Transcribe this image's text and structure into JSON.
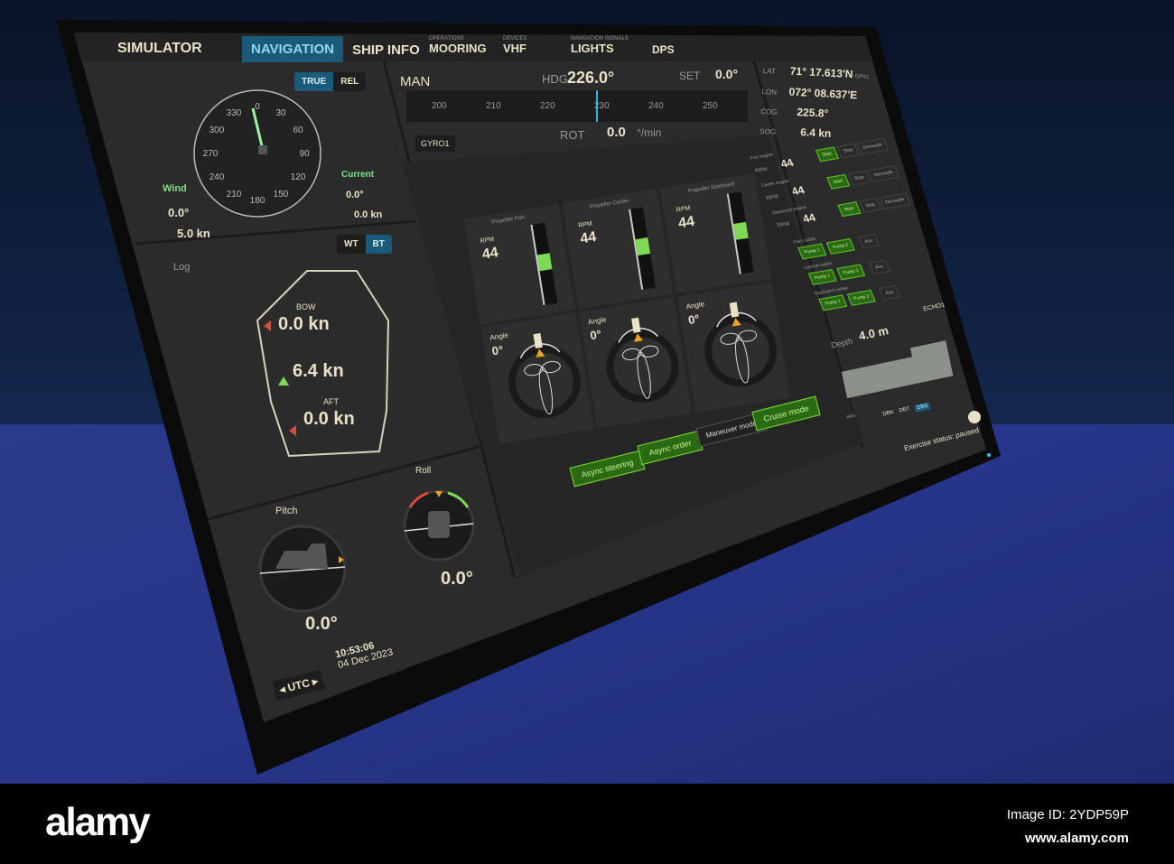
{
  "tabs": [
    {
      "label": "SIMULATOR",
      "sub": ""
    },
    {
      "label": "NAVIGATION",
      "sub": ""
    },
    {
      "label": "SHIP INFO",
      "sub": ""
    },
    {
      "label": "MOORING",
      "sub": "OPERATIONS"
    },
    {
      "label": "VHF",
      "sub": "DEVICES"
    },
    {
      "label": "LIGHTS",
      "sub": "NAVIGATION SIGNALS"
    },
    {
      "label": "DPS",
      "sub": ""
    }
  ],
  "wind": {
    "mode_true": "TRUE",
    "mode_rel": "REL",
    "compass_ticks": [
      "0",
      "30",
      "60",
      "90",
      "120",
      "150",
      "180",
      "210",
      "240",
      "270",
      "300",
      "330"
    ],
    "wind_label": "Wind",
    "wind_dir": "0.0°",
    "wind_speed": "5.0 kn",
    "current_label": "Current",
    "current_dir": "0.0°",
    "current_speed": "0.0 kn"
  },
  "heading": {
    "mode": "MAN",
    "hdg_label": "HDG",
    "hdg_value": "226.0°",
    "set_label": "SET",
    "set_value": "0.0°",
    "scale": [
      "200",
      "210",
      "220",
      "230",
      "240",
      "250"
    ],
    "rot_label": "ROT",
    "rot_value": "0.0",
    "rot_unit": "°/min",
    "gyro": "GYRO1"
  },
  "position": {
    "lat_label": "LAT",
    "lat": "71° 17.613'N",
    "gps": "GPS1",
    "lon_label": "LON",
    "lon": "072° 08.637'E",
    "cog_label": "COG",
    "cog": "225.8°",
    "sog_label": "SOG",
    "sog": "6.4 kn"
  },
  "engines": [
    {
      "name": "Port engine",
      "rpm_label": "RPM",
      "rpm": "44",
      "start": "Start",
      "stop": "Stop",
      "third": "Decouple"
    },
    {
      "name": "Center engine",
      "rpm_label": "RPM",
      "rpm": "44",
      "start": "Start",
      "stop": "Stop",
      "third": "Decouple"
    },
    {
      "name": "Starboard engine",
      "rpm_label": "RPM",
      "rpm": "44",
      "start": "Start",
      "stop": "Stop",
      "third": "Decouple"
    }
  ],
  "rudders": [
    {
      "name": "Port rudder",
      "pump1": "Pump 1",
      "pump2": "Pump 2",
      "aux": "Aux"
    },
    {
      "name": "Central rudder",
      "pump1": "Pump 1",
      "pump2": "Pump 2",
      "aux": "Aux"
    },
    {
      "name": "Starboard rudder",
      "pump1": "Pump 1",
      "pump2": "Pump 2",
      "aux": "Aux"
    }
  ],
  "depth": {
    "label": "Depth",
    "value": "4.0 m",
    "source": "ECHO1",
    "unit": "min",
    "modes": [
      "DBK",
      "DBT",
      "DBS"
    ],
    "status": "Exercise status: paused"
  },
  "log": {
    "label": "Log",
    "wt": "WT",
    "bt": "BT",
    "bow_label": "BOW",
    "bow": "0.0 kn",
    "mid": "6.4 kn",
    "aft_label": "AFT",
    "aft": "0.0 kn"
  },
  "attitude": {
    "pitch_label": "Pitch",
    "pitch": "0.0°",
    "roll_label": "Roll",
    "roll": "0.0°"
  },
  "clock": {
    "tz": "UTC",
    "time": "10:53:06",
    "date": "04 Dec 2023"
  },
  "propellers": [
    {
      "name": "Propeller Port",
      "rpm_label": "RPM",
      "rpm": "44",
      "angle_label": "Angle",
      "angle": "0°",
      "fill": 0.35
    },
    {
      "name": "Propeller Center",
      "rpm_label": "RPM",
      "rpm": "44",
      "angle_label": "Angle",
      "angle": "0°",
      "fill": 0.35
    },
    {
      "name": "Propeller Starboard",
      "rpm_label": "RPM",
      "rpm": "44",
      "angle_label": "Angle",
      "angle": "0°",
      "fill": 0.35
    }
  ],
  "modes": {
    "async_steering": "Async steering",
    "async_order": "Async order",
    "maneuver": "Maneuver mode",
    "cruise": "Cruise mode"
  },
  "watermark": {
    "logo": "alamy",
    "image_id": "Image ID: 2YDP59P",
    "url": "www.alamy.com"
  }
}
